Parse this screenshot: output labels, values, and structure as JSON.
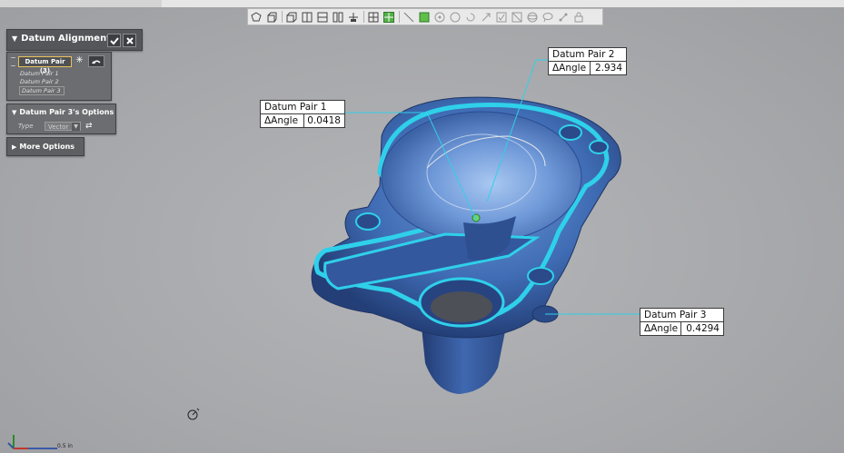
{
  "panels": {
    "alignment": {
      "title": "Datum Alignment",
      "icons": [
        "triangle-down-icon",
        "check-icon",
        "close-icon"
      ]
    },
    "pairs": {
      "selected_label": "Datum Pair (3)",
      "icons": [
        "asterisk-icon",
        "undo-icon"
      ],
      "items": [
        "Datum Pair 1",
        "Datum Pair 2",
        "Datum Pair 3"
      ]
    },
    "options": {
      "title": "Datum Pair 3's Options",
      "type_label": "Type",
      "type_value": "Vector",
      "icons": [
        "swap-arrows-icon"
      ]
    },
    "more": {
      "title": "More Options"
    }
  },
  "callouts": [
    {
      "name": "Datum Pair 1",
      "key": "ΔAngle",
      "value": "0.0418"
    },
    {
      "name": "Datum Pair 2",
      "key": "ΔAngle",
      "value": "2.934"
    },
    {
      "name": "Datum Pair 3",
      "key": "ΔAngle",
      "value": "0.4294"
    }
  ],
  "scale": {
    "label": "0.5 in"
  },
  "colors": {
    "background": "#a9aaad",
    "part_blue": "#3f6fb8",
    "highlight_cyan": "#2fd0ea",
    "selected_outline": "#e8c260"
  },
  "toolbar_icons": [
    "shape-select-icon",
    "cube-select-icon",
    "cube-view-icon",
    "view-front-icon",
    "view-top-icon",
    "view-side-icon",
    "align-icon",
    "grid-icon",
    "grid-active-icon",
    "line-tool-icon",
    "square-tool-icon",
    "target-tool-icon",
    "circle-tool-icon",
    "rotate-tool-icon",
    "transform-tool-icon",
    "checkbox-tool-icon",
    "mesh-tool-icon",
    "sphere-tool-icon",
    "lasso-tool-icon",
    "points-tool-icon",
    "lock-tool-icon"
  ]
}
